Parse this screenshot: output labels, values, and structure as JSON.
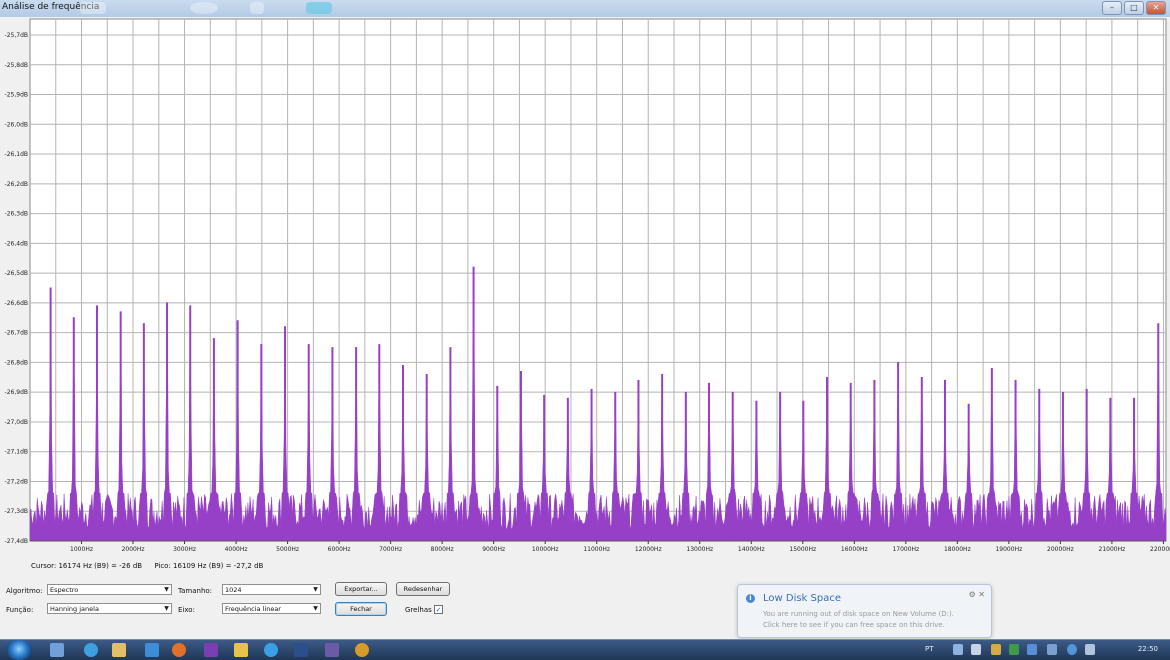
{
  "window": {
    "title": "Análise de frequência"
  },
  "colors": {
    "spectrum_fill": "#9540c6",
    "grid": "#b4b4b4",
    "plot_bg": "#ffffff"
  },
  "chart_data": {
    "type": "area",
    "title": "",
    "xlabel": "",
    "ylabel": "",
    "grid": true,
    "y_ticks": [
      "-25,7dB",
      "-25,8dB",
      "-25,9dB",
      "-26,0dB",
      "-26,1dB",
      "-26,2dB",
      "-26,3dB",
      "-26,4dB",
      "-26,5dB",
      "-26,6dB",
      "-26,7dB",
      "-26,8dB",
      "-26,9dB",
      "-27,0dB",
      "-27,1dB",
      "-27,2dB",
      "-27,3dB",
      "-27,4dB"
    ],
    "x_ticks": [
      "1000Hz",
      "2000Hz",
      "3000Hz",
      "4000Hz",
      "5000Hz",
      "6000Hz",
      "7000Hz",
      "8000Hz",
      "9000Hz",
      "10000Hz",
      "11000Hz",
      "12000Hz",
      "13000Hz",
      "14000Hz",
      "15000Hz",
      "16000Hz",
      "17000Hz",
      "18000Hz",
      "19000Hz",
      "20000Hz",
      "21000Hz",
      "22000Hz"
    ],
    "xlim": [
      0,
      22050
    ],
    "ylim": [
      -27.45,
      -25.7
    ],
    "peaks": [
      {
        "x": 400,
        "y": -26.6
      },
      {
        "x": 850,
        "y": -26.7
      },
      {
        "x": 1300,
        "y": -26.66
      },
      {
        "x": 1760,
        "y": -26.68
      },
      {
        "x": 2210,
        "y": -26.72
      },
      {
        "x": 2660,
        "y": -26.65
      },
      {
        "x": 3110,
        "y": -26.66
      },
      {
        "x": 3570,
        "y": -26.77
      },
      {
        "x": 4030,
        "y": -26.71
      },
      {
        "x": 4490,
        "y": -26.79
      },
      {
        "x": 4950,
        "y": -26.73
      },
      {
        "x": 5410,
        "y": -26.79
      },
      {
        "x": 5870,
        "y": -26.8
      },
      {
        "x": 6330,
        "y": -26.8
      },
      {
        "x": 6780,
        "y": -26.79
      },
      {
        "x": 7240,
        "y": -26.86
      },
      {
        "x": 7700,
        "y": -26.89
      },
      {
        "x": 8160,
        "y": -26.8
      },
      {
        "x": 8610,
        "y": -26.53
      },
      {
        "x": 9070,
        "y": -26.93
      },
      {
        "x": 9530,
        "y": -26.88
      },
      {
        "x": 9980,
        "y": -26.96
      },
      {
        "x": 10440,
        "y": -26.97
      },
      {
        "x": 10900,
        "y": -26.94
      },
      {
        "x": 11360,
        "y": -26.95
      },
      {
        "x": 11810,
        "y": -26.91
      },
      {
        "x": 12270,
        "y": -26.89
      },
      {
        "x": 12730,
        "y": -26.95
      },
      {
        "x": 13180,
        "y": -26.92
      },
      {
        "x": 13640,
        "y": -26.95
      },
      {
        "x": 14100,
        "y": -26.98
      },
      {
        "x": 14560,
        "y": -26.95
      },
      {
        "x": 15010,
        "y": -26.98
      },
      {
        "x": 15470,
        "y": -26.9
      },
      {
        "x": 15930,
        "y": -26.92
      },
      {
        "x": 16390,
        "y": -26.91
      },
      {
        "x": 16850,
        "y": -26.85
      },
      {
        "x": 17310,
        "y": -26.9
      },
      {
        "x": 17760,
        "y": -26.91
      },
      {
        "x": 18220,
        "y": -26.99
      },
      {
        "x": 18670,
        "y": -26.87
      },
      {
        "x": 19130,
        "y": -26.91
      },
      {
        "x": 19590,
        "y": -26.94
      },
      {
        "x": 20050,
        "y": -26.95
      },
      {
        "x": 20510,
        "y": -26.94
      },
      {
        "x": 20970,
        "y": -26.97
      },
      {
        "x": 21430,
        "y": -26.97
      },
      {
        "x": 21900,
        "y": -26.72
      }
    ],
    "noise_floor_db": -27.35
  },
  "status": {
    "cursor": "Cursor: 16174 Hz (B9) = -26 dB",
    "peak": "Pico: 16109 Hz (B9) = -27,2 dB"
  },
  "controls": {
    "algorithm_label": "Algoritmo:",
    "algorithm_value": "Espectro",
    "size_label": "Tamanho:",
    "size_value": "1024",
    "function_label": "Função:",
    "function_value": "Hanning janela",
    "axis_label": "Eixo:",
    "axis_value": "Frequência linear",
    "export_label": "Exportar...",
    "redraw_label": "Redesenhar",
    "close_label": "Fechar",
    "grid_label": "Grelhas",
    "grid_checked": "✓"
  },
  "notification": {
    "title": "Low Disk Space",
    "line1": "You are running out of disk space on New Volume (D:).",
    "line2": "Click here to see if you can free space on this drive."
  },
  "taskbar": {
    "language": "PT",
    "clock": "22:50"
  }
}
